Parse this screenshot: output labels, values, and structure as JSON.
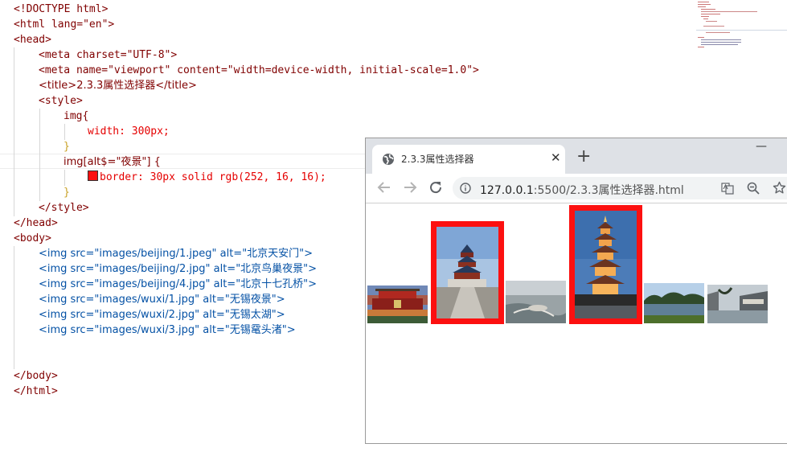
{
  "editor": {
    "lines": [
      "<!DOCTYPE html>",
      "<html lang=\"en\">",
      "<head>",
      "<meta charset=\"UTF-8\">",
      "<meta name=\"viewport\" content=\"width=device-width, initial-scale=1.0\">",
      "<title>2.3.3属性选择器</title>",
      "<style>",
      "img{",
      "width: 300px;",
      "}",
      "img[alt$=\"夜景\"] {",
      "border: 30px solid rgb(252, 16, 16);",
      "}",
      "</style>",
      "</head>",
      "<body>",
      "<img src=\"images/beijing/1.jpeg\" alt=\"北京天安门\">",
      "<img src=\"images/beijing/2.jpg\" alt=\"北京鸟巢夜景\">",
      "<img src=\"images/beijing/4.jpg\" alt=\"北京十七孔桥\">",
      "<img src=\"images/wuxi/1.jpg\" alt=\"无锡夜景\">",
      "<img src=\"images/wuxi/2.jpg\" alt=\"无锡太湖\">",
      "<img src=\"images/wuxi/3.jpg\" alt=\"无锡鼋头渚\">",
      "</body>",
      "</html>"
    ],
    "swatch_color": "#fc1010"
  },
  "browser": {
    "tab_title": "2.3.3属性选择器",
    "close_glyph": "✕",
    "new_tab_glyph": "+",
    "minimize_glyph": "—",
    "url_host": "127.0.0.1",
    "url_rest": ":5500/2.3.3属性选择器.html",
    "border_color": "#fc1010",
    "images": [
      {
        "alt": "北京天安门",
        "framed": false
      },
      {
        "alt": "北京鸟巢夜景",
        "framed": true
      },
      {
        "alt": "北京十七孔桥",
        "framed": false
      },
      {
        "alt": "无锡夜景",
        "framed": true
      },
      {
        "alt": "无锡太湖",
        "framed": false
      },
      {
        "alt": "无锡鼋头渚",
        "framed": false
      }
    ]
  },
  "icons": {
    "tab": "globe-icon",
    "back": "arrow-left-icon",
    "forward": "arrow-right-icon",
    "reload": "reload-icon",
    "site_info": "info-icon",
    "translate": "translate-icon",
    "zoom": "zoom-out-icon",
    "bookmark": "star-icon"
  }
}
